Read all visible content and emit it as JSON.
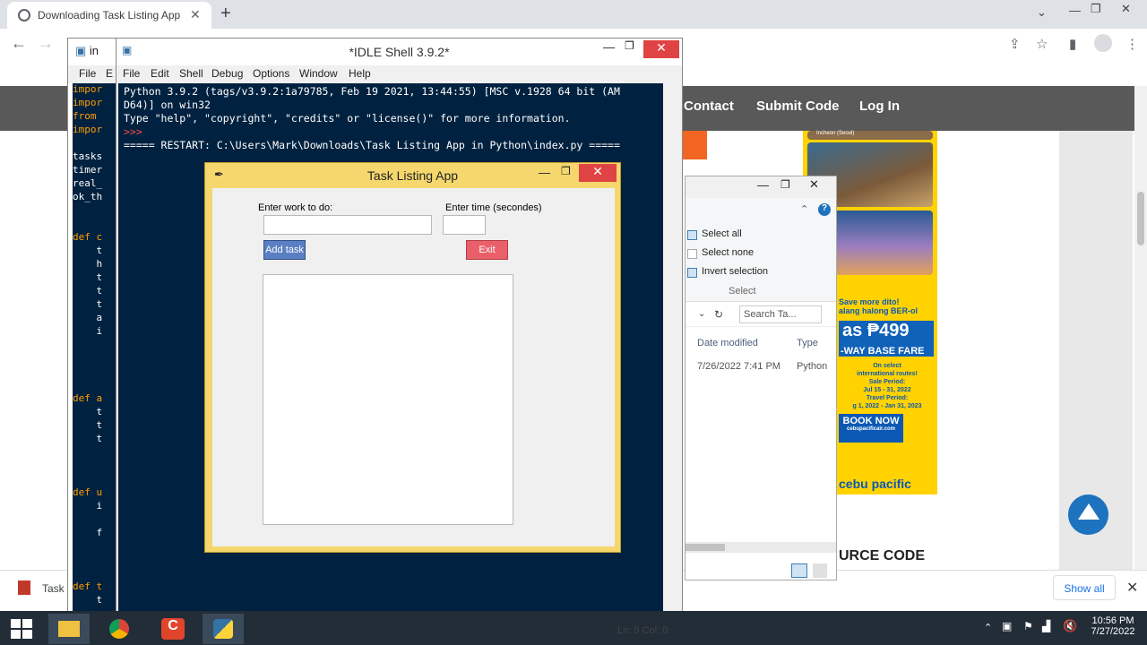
{
  "browser": {
    "tab_title": "Downloading Task Listing App in Python with Source Code",
    "new_tab": "+",
    "minimize": "—",
    "maximize": "❐",
    "close": "✕"
  },
  "site": {
    "nav": [
      "Contact",
      "Submit Code",
      "Log In"
    ],
    "source_heading": "URCE CODE"
  },
  "ad": {
    "city": "Incheon (Seoul)",
    "line1": "Save more dito!",
    "line2": "alang halong BER-ol",
    "price": "as ₱499",
    "base": "-WAY BASE FARE",
    "small1": "On select",
    "small2": "international routes!",
    "small3": "Sale Period:",
    "small4": "Jul 15 - 31, 2022",
    "small5": "Travel Period:",
    "small6": "g 1, 2022 - Jan 31, 2023",
    "book": "BOOK NOW",
    "book_sub": "cebupacificair.com",
    "logo": "cebu pacific"
  },
  "download": {
    "name": "Task",
    "show_all": "Show all",
    "close": "✕"
  },
  "explorer": {
    "select_all": "Select all",
    "select_none": "Select none",
    "invert": "Invert selection",
    "group": "Select",
    "search": "Search Ta...",
    "col_date": "Date modified",
    "col_type": "Type",
    "row_date": "7/26/2022 7:41 PM",
    "row_type": "Python"
  },
  "editor": {
    "tab": "in",
    "menu": [
      "File",
      "E"
    ],
    "code": [
      "impor",
      "impor",
      "from",
      "impor",
      "",
      "tasks",
      "timer",
      "real_",
      "ok_th",
      "",
      "",
      "def c",
      "    t",
      "    h",
      "    t",
      "    t",
      "    t",
      "    a",
      "    i",
      "",
      "",
      "",
      "",
      "def a",
      "    t",
      "    t",
      "    t",
      "",
      "",
      "",
      "def u",
      "    i",
      "",
      "    f",
      "",
      "",
      "",
      "def t",
      "    t"
    ]
  },
  "shell": {
    "title": "*IDLE Shell 3.9.2*",
    "menu": [
      "File",
      "Edit",
      "Shell",
      "Debug",
      "Options",
      "Window",
      "Help"
    ],
    "lines": [
      "Python 3.9.2 (tags/v3.9.2:1a79785, Feb 19 2021, 13:44:55) [MSC v.1928 64 bit (AM",
      "D64)] on win32",
      "Type \"help\", \"copyright\", \"credits\" or \"license()\" for more information.",
      ">>> ",
      "===== RESTART: C:\\Users\\Mark\\Downloads\\Task Listing App in Python\\index.py ====="
    ],
    "status": "Ln: 5   Col: 0"
  },
  "app": {
    "title": "Task Listing App",
    "work_label": "Enter work to do:",
    "time_label": "Enter time (secondes)",
    "work_value": "",
    "time_value": "",
    "add_button": "Add task",
    "exit_button": "Exit"
  },
  "taskbar": {
    "time": "10:56 PM",
    "date": "7/27/2022"
  },
  "colors": {
    "shell_bg": "#002240",
    "dialog_frame": "#f5d76e",
    "add_button": "#5a7fc2",
    "exit_button": "#e9606a",
    "nav_bg": "#595959",
    "ad_bg": "#ffd200"
  }
}
